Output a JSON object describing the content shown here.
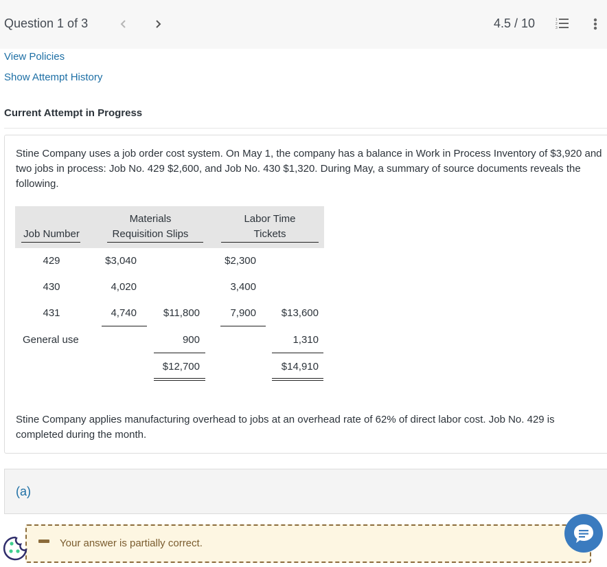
{
  "header": {
    "question_label": "Question 1 of 3",
    "score": "4.5 / 10",
    "prev_icon": "chevron-left-icon",
    "next_icon": "chevron-right-icon",
    "list_icon": "numbered-list-icon",
    "more_icon": "more-vertical-icon"
  },
  "links": {
    "view_policies": "View Policies",
    "show_attempt_history": "Show Attempt History"
  },
  "attempt_status": "Current Attempt in Progress",
  "question": {
    "intro": "Stine Company uses a job order cost system. On May 1, the company has a balance in Work in Process Inventory of $3,920 and two jobs in process: Job No. 429 $2,600, and Job No. 430 $1,320. During May, a summary of source documents reveals the following.",
    "outro": "Stine Company applies manufacturing overhead to jobs at an overhead rate of 62% of direct labor cost. Job No. 429 is completed during the month.",
    "table": {
      "headers": {
        "job_number": "Job Number",
        "materials_line1": "Materials",
        "materials_line2": "Requisition Slips",
        "labor_line1": "Labor Time",
        "labor_line2": "Tickets"
      },
      "rows": [
        {
          "job": "429",
          "materials": "$3,040",
          "materials_total": "",
          "labor": "$2,300",
          "labor_total": ""
        },
        {
          "job": "430",
          "materials": "4,020",
          "materials_total": "",
          "labor": "3,400",
          "labor_total": ""
        },
        {
          "job": "431",
          "materials": "4,740",
          "materials_total": "$11,800",
          "labor": "7,900",
          "labor_total": "$13,600"
        },
        {
          "job": "General use",
          "materials": "",
          "materials_total": "900",
          "labor": "",
          "labor_total": "1,310"
        },
        {
          "job": "",
          "materials": "",
          "materials_total": "$12,700",
          "labor": "",
          "labor_total": "$14,910"
        }
      ]
    }
  },
  "part": {
    "label": "(a)"
  },
  "feedback": {
    "text": "Your answer is partially correct.",
    "status_color": "#8b6b3a",
    "background": "#fdf6e2"
  },
  "colors": {
    "link": "#1d6fa5",
    "chat_button": "#3a7bbf"
  }
}
